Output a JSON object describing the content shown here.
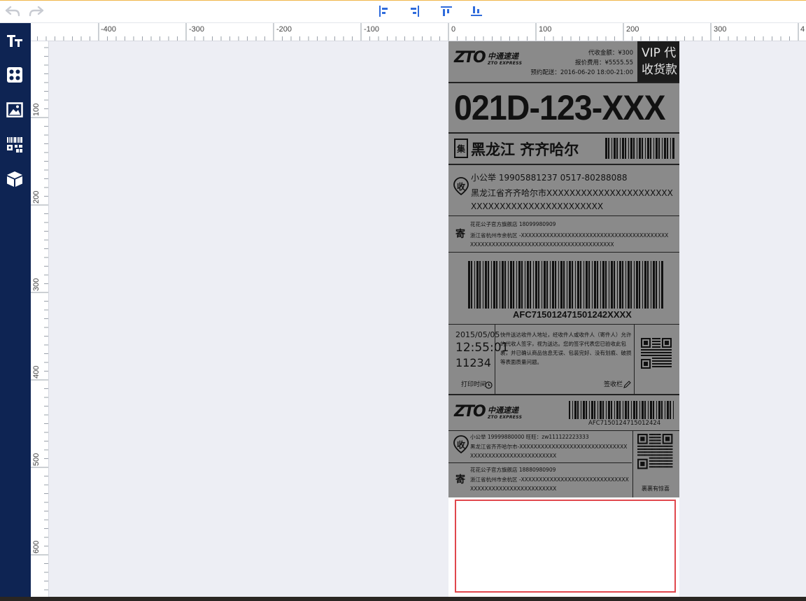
{
  "toolbar": {
    "undo_icon": "undo-arrow-icon",
    "redo_icon": "redo-arrow-icon",
    "align_buttons": [
      "align-left-icon",
      "align-right-icon",
      "align-top-icon",
      "align-bottom-icon"
    ],
    "accent": "#2f6bdc"
  },
  "sidebar": {
    "bg": "#0e2453",
    "items": [
      "text-tool-icon",
      "shapes-tool-icon",
      "image-tool-icon",
      "barcode-qr-tool-icon",
      "box-3d-tool-icon"
    ]
  },
  "ruler": {
    "h_labels": [
      "-400",
      "-300",
      "-200",
      "-100",
      "0",
      "100",
      "200",
      "300",
      "4"
    ],
    "v_labels": [
      "100",
      "200",
      "300",
      "400",
      "500",
      "600"
    ]
  },
  "label": {
    "header": {
      "logo": "ZTO",
      "logo_cn": "中通速递",
      "logo_en": "ZTO EXPRESS",
      "cod_line": "代收金额：¥300",
      "insured_line": "报价费用：¥5555.55",
      "appoint_line": "预约配送：2016-06-20 18:00-21:00",
      "vip_line1": "VIP 代",
      "vip_line2": "收货款"
    },
    "sort_code": "021D-123-XXX",
    "dest": {
      "badge": "集",
      "city": "黑龙江  齐齐哈尔"
    },
    "recipient": {
      "badge": "收",
      "name_phone": "小公举    19905881237    0517-80288088",
      "addr1": "黑龙江省齐齐哈尔市XXXXXXXXXXXXXXXXXXXXXX",
      "addr2": "XXXXXXXXXXXXXXXXXXXXXXX"
    },
    "sender": {
      "badge": "寄",
      "name_phone": "花花公子官方旗舰店    18099980909",
      "addr1": "浙江省杭州市余杭区 -XXXXXXXXXXXXXXXXXXXXXXXXXXXXXXXXXXXXXXXXX",
      "addr2": "XXXXXXXXXXXXXXXXXXXXXXXXXXXXXXXXXXXXXXXX"
    },
    "tracking_number": "AFC715012471501242XXXX",
    "print": {
      "date": "2015/05/05",
      "time": "12:55:01",
      "code": "11234",
      "label": "打印时间"
    },
    "notice": "快件送达收件人地址，经收件人或收件人（寄件人）允许的代收人签字，视为送达。您的签字代表您已验收此包裹，并已确认商品信息无误、包装完好、没有划痕、破损等表面质量问题。",
    "sign_label": "签收栏",
    "stub": {
      "logo": "ZTO",
      "logo_cn": "中通速递",
      "logo_en": "ZTO EXPRESS",
      "tracking": "AFC7150124715012424",
      "recipient_badge": "收",
      "recipient_line1": "小公举    19999880000    旺旺：zw111122223333",
      "recipient_line2": "黑龙江省齐齐哈尔市-XXXXXXXXXXXXXXXXXXXXXXXXXXXXXX",
      "recipient_line3": "XXXXXXXXXXXXXXXXXXXXXXXX",
      "sender_badge": "寄",
      "sender_line1": "花花公子官方旗舰店    18880980909",
      "sender_line2": "浙江省杭州市余杭区 -XXXXXXXXXXXXXXXXXXXXXXXXXXXXXX",
      "sender_line3": "XXXXXXXXXXXXXXXXXXXXXXXX",
      "qr_caption": "裹裹有惊喜"
    },
    "sign_box_color": "#e0474c"
  }
}
